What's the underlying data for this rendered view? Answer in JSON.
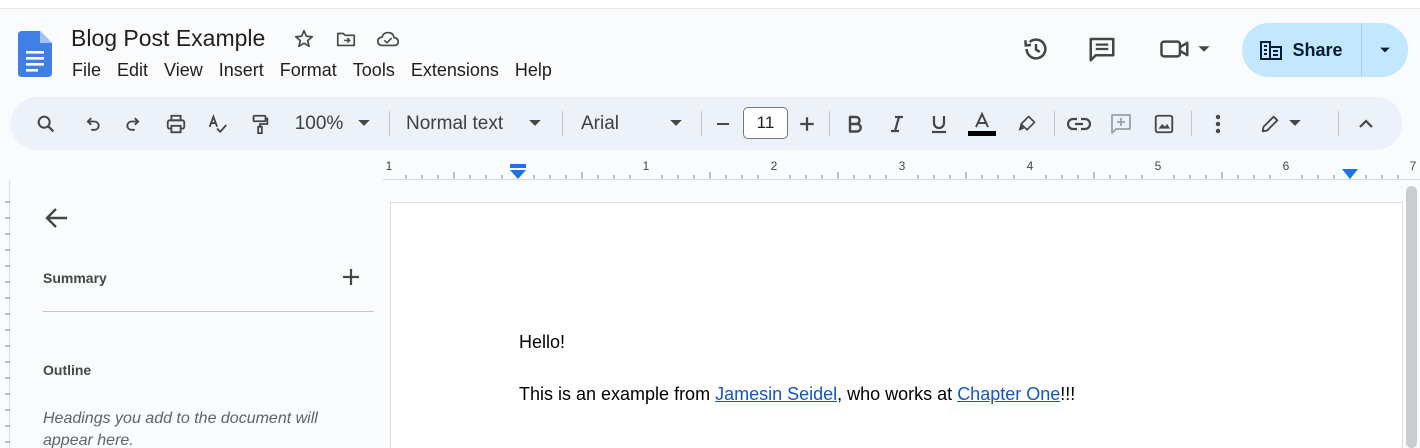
{
  "document": {
    "title": "Blog Post Example"
  },
  "menu": [
    "File",
    "Edit",
    "View",
    "Insert",
    "Format",
    "Tools",
    "Extensions",
    "Help"
  ],
  "share": {
    "label": "Share"
  },
  "toolbar": {
    "zoom": "100%",
    "style": "Normal text",
    "font": "Arial",
    "font_size": "11"
  },
  "ruler": {
    "numbers": [
      "1",
      "1",
      "2",
      "3",
      "4",
      "5",
      "6",
      "7"
    ]
  },
  "sidebar": {
    "summary_label": "Summary",
    "outline_label": "Outline",
    "outline_hint": "Headings you add to the document will appear here."
  },
  "body": {
    "line1": "Hello!",
    "line2_prefix": "This is an example from ",
    "link1": "Jamesin Seidel",
    "line2_middle": ", who works at ",
    "link2": "Chapter One",
    "line2_suffix": "!!!"
  },
  "colors": {
    "accent": "#1a73e8",
    "share_bg": "#c2e7ff",
    "toolbar_bg": "#edf2fa",
    "link": "#1155cc"
  },
  "icons": [
    "docs-logo-icon",
    "star-icon",
    "move-folder-icon",
    "cloud-saved-icon",
    "history-icon",
    "comments-icon",
    "meet-icon",
    "search-icon",
    "undo-icon",
    "redo-icon",
    "print-icon",
    "spellcheck-icon",
    "paint-format-icon",
    "bold-icon",
    "italic-icon",
    "underline-icon",
    "text-color-icon",
    "highlight-icon",
    "link-icon",
    "add-comment-icon",
    "insert-image-icon",
    "more-icon",
    "editing-mode-icon",
    "collapse-icon"
  ]
}
